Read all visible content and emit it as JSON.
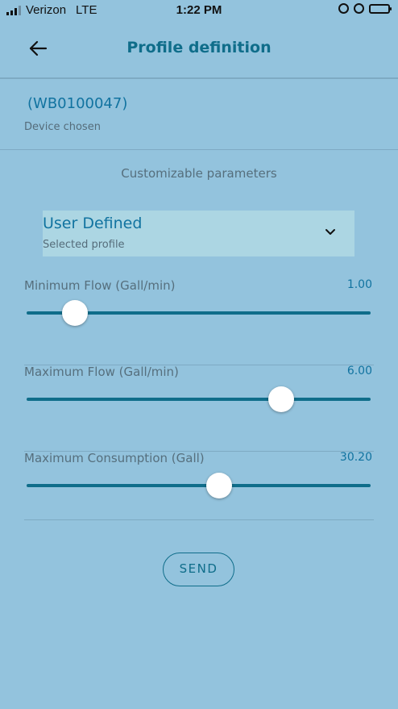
{
  "status_bar": {
    "carrier": "Verizon",
    "network": "LTE",
    "time": "1:22 PM",
    "signal_bars": 3,
    "signal_bars_total": 4,
    "icons": [
      "orientation-lock-icon",
      "alarm-icon",
      "battery-icon"
    ],
    "battery_level": 1.0
  },
  "header": {
    "title": "Profile definition",
    "back_icon": "arrow-left-icon"
  },
  "device": {
    "id": "(WB0100047)",
    "caption": "Device chosen"
  },
  "section_title": "Customizable parameters",
  "profile_dropdown": {
    "value": "User Defined",
    "caption": "Selected profile",
    "icon": "chevron-down-icon"
  },
  "parameters": [
    {
      "label": "Minimum Flow (Gall/min)",
      "value": "1.00",
      "slider_fraction": 0.14
    },
    {
      "label": "Maximum Flow (Gall/min)",
      "value": "6.00",
      "slider_fraction": 0.74
    },
    {
      "label": "Maximum Consumption (Gall)",
      "value": "30.20",
      "slider_fraction": 0.56
    }
  ],
  "send_button": {
    "label": "SEND"
  },
  "colors": {
    "background": "#93c3dd",
    "accent": "#0f6d8a",
    "value_text": "#1173a0",
    "dropdown_bg": "#acd6e3",
    "muted_text": "#566f7d"
  }
}
